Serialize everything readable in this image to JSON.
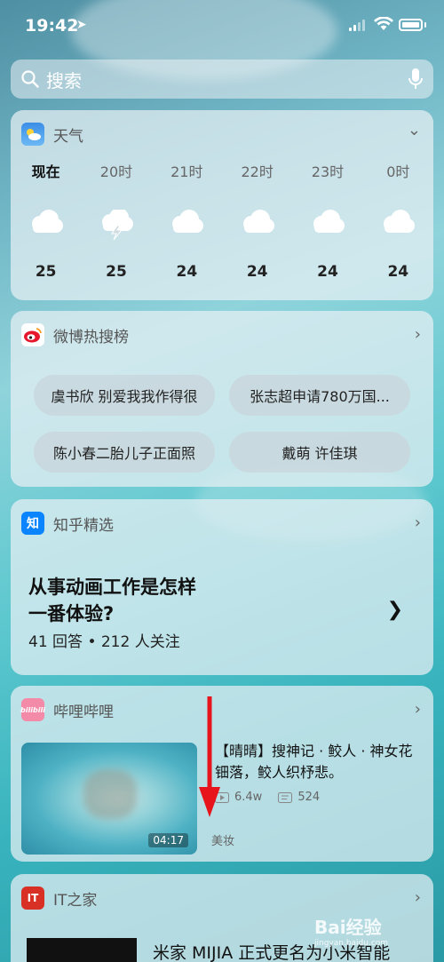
{
  "status_bar": {
    "time": "19:42"
  },
  "search": {
    "placeholder": "搜索"
  },
  "weather": {
    "title": "天气",
    "hours": [
      {
        "label": "现在",
        "icon": "cloud-icon",
        "temp": "25"
      },
      {
        "label": "20时",
        "icon": "thunder-icon",
        "temp": "25"
      },
      {
        "label": "21时",
        "icon": "cloud-icon",
        "temp": "24"
      },
      {
        "label": "22时",
        "icon": "cloud-icon",
        "temp": "24"
      },
      {
        "label": "23时",
        "icon": "cloud-icon",
        "temp": "24"
      },
      {
        "label": "0时",
        "icon": "cloud-icon",
        "temp": "24"
      }
    ]
  },
  "weibo": {
    "title": "微博热搜榜",
    "items": [
      "虞书欣 别爱我我作得很",
      "张志超申请780万国...",
      "陈小春二胎儿子正面照",
      "戴萌 许佳琪"
    ]
  },
  "zhihu": {
    "title": "知乎精选",
    "icon_text": "知",
    "question_line1": "从事动画工作是怎样",
    "question_line2": "一番体验?",
    "meta": "41 回答 • 212 人关注"
  },
  "bilibili": {
    "title": "哔哩哔哩",
    "icon_text": "bilibili",
    "video_title": "【晴晴】搜神记 · 鲛人 · 神女花钿落，鲛人织杼悲。",
    "duration": "04:17",
    "views": "6.4w",
    "comments": "524",
    "tag": "美妆"
  },
  "ithome": {
    "title": "IT之家",
    "icon_text": "IT",
    "headline": "米家 MIJIA 正式更名为小米智能"
  },
  "watermark": {
    "text": "Bai经验",
    "sub": "jingyan.baidu.com"
  },
  "colors": {
    "weibo_red": "#e6162d",
    "zhihu_blue": "#0a84ff",
    "bili_pink": "#f38aa8",
    "ithome_red": "#d93025",
    "arrow_red": "#e8141c"
  }
}
